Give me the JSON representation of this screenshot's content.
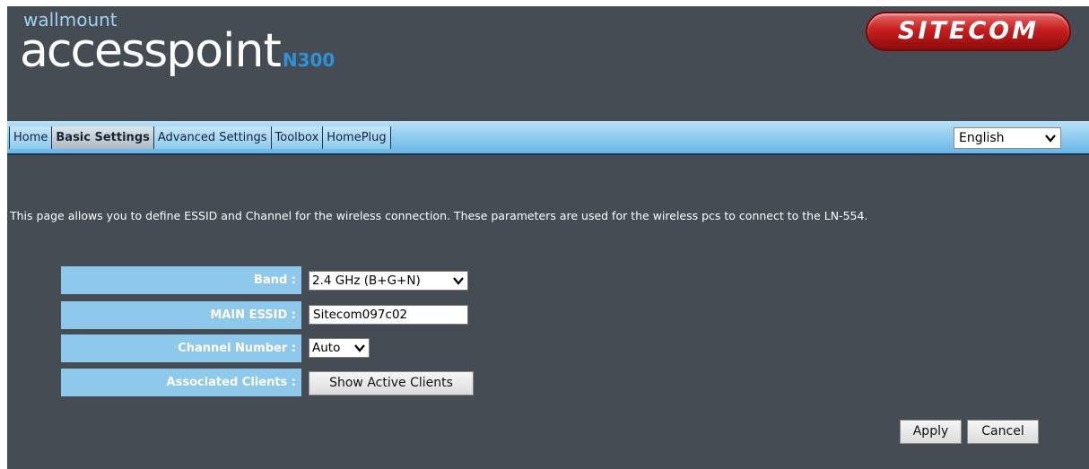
{
  "header": {
    "brand_small": "wallmount",
    "brand_access": "access",
    "brand_point": "point",
    "brand_model": "N300",
    "logo_text": "SITECOM"
  },
  "nav": {
    "tabs": [
      {
        "label": "Home",
        "active": false
      },
      {
        "label": "Basic Settings",
        "active": true
      },
      {
        "label": "Advanced Settings",
        "active": false
      },
      {
        "label": "Toolbox",
        "active": false
      },
      {
        "label": "HomePlug",
        "active": false
      }
    ],
    "language": {
      "selected": "English",
      "icon": "chevron-down-icon"
    }
  },
  "description": "This page allows you to define ESSID and Channel for the wireless connection. These parameters are used for the wireless pcs to connect to the LN-554.",
  "form": {
    "band": {
      "label": "Band :",
      "value": "2.4 GHz (B+G+N)"
    },
    "essid": {
      "label": "MAIN ESSID :",
      "value": "Sitecom097c02"
    },
    "channel": {
      "label": "Channel Number :",
      "value": "Auto"
    },
    "clients": {
      "label": "Associated Clients :",
      "button": "Show Active Clients"
    }
  },
  "actions": {
    "apply": "Apply",
    "cancel": "Cancel"
  },
  "colors": {
    "background": "#464c54",
    "label_bg": "#8ec8ea",
    "brand_accent": "#2d93d6",
    "logo_red": "#c81e1e"
  }
}
